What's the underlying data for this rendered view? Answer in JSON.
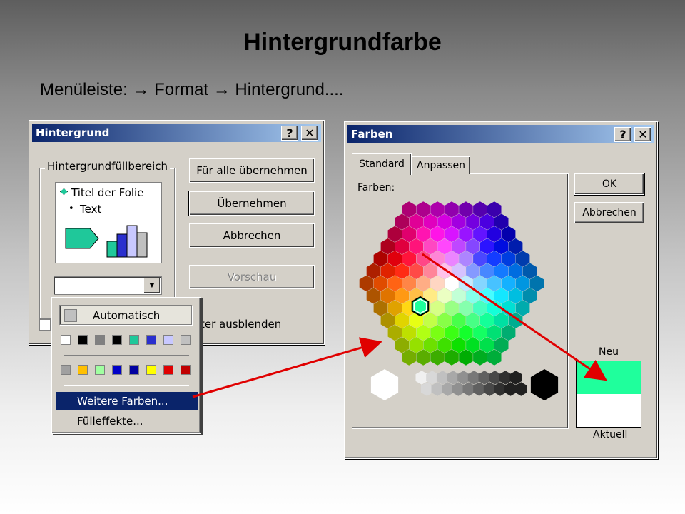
{
  "slide": {
    "title": "Hintergrundfarbe",
    "subtitle": "Menüleiste:  → Format  → Hintergrund...."
  },
  "dialog_hintergrund": {
    "title": "Hintergrund",
    "help_label": "?",
    "close_label": "✕",
    "group_label": "Hintergrundfüllbereich",
    "preview_title": "Titel der Folie",
    "preview_bullet": "•",
    "preview_text": "Text",
    "buttons": {
      "apply_all": "Für alle übernehmen",
      "apply": "Übernehmen",
      "cancel": "Abbrechen",
      "preview": "Vorschau"
    },
    "hide_graphics_label": "ter ausblenden",
    "dropdown_arrow": "▼"
  },
  "color_menu": {
    "automatic_label": "Automatisch",
    "row1_colors": [
      "#ffffff",
      "#000000",
      "#808080",
      "#000000",
      "#1fc89a",
      "#2a2fce",
      "#c8c8ff",
      "#c0c0c0"
    ],
    "row2_colors": [
      "#a0a0a0",
      "#ffc000",
      "#a0ffa0",
      "#0000c8",
      "#0000a0",
      "#ffff00",
      "#e00000",
      "#c00000"
    ],
    "more_colors_label": "Weitere Farben...",
    "fill_effects_label": "Fülleffekte..."
  },
  "dialog_farben": {
    "title": "Farben",
    "help_label": "?",
    "close_label": "✕",
    "tabs": [
      "Standard",
      "Anpassen"
    ],
    "colors_label": "Farben:",
    "ok_label": "OK",
    "cancel_label": "Abbrechen",
    "new_label": "Neu",
    "current_label": "Aktuell",
    "new_color": "#1fff9c",
    "current_color": "#ffffff"
  },
  "accent_colors": {
    "arrow": "#e00000",
    "titlebar_start": "#0a246a",
    "titlebar_end": "#a6caf0",
    "menu_highlight": "#0a246a"
  }
}
